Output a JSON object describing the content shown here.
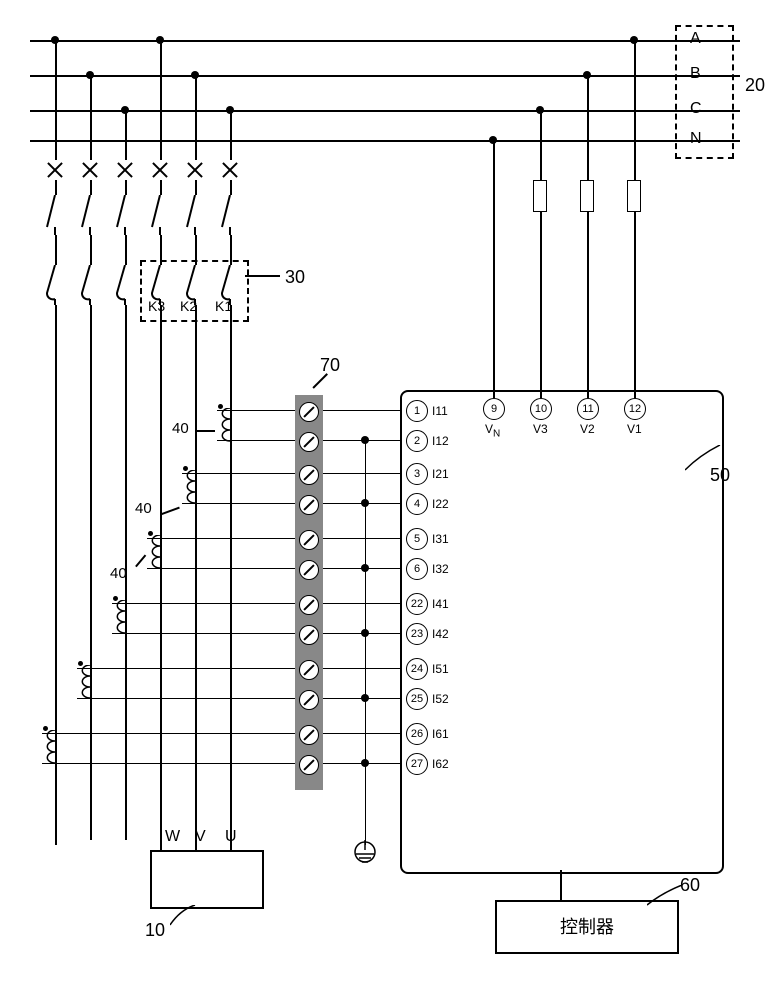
{
  "bus": {
    "A": "A",
    "B": "B",
    "C": "C",
    "N": "N"
  },
  "contactor": {
    "K1": "K1",
    "K2": "K2",
    "K3": "K3"
  },
  "motor_terminals": {
    "W": "W",
    "V": "V",
    "U": "U"
  },
  "ct_label": "40",
  "terminal_strip": "70",
  "device_terminals": {
    "t1": {
      "num": "1",
      "name": "I11"
    },
    "t2": {
      "num": "2",
      "name": "I12"
    },
    "t3": {
      "num": "3",
      "name": "I21"
    },
    "t4": {
      "num": "4",
      "name": "I22"
    },
    "t5": {
      "num": "5",
      "name": "I31"
    },
    "t6": {
      "num": "6",
      "name": "I32"
    },
    "t22": {
      "num": "22",
      "name": "I41"
    },
    "t23": {
      "num": "23",
      "name": "I42"
    },
    "t24": {
      "num": "24",
      "name": "I51"
    },
    "t25": {
      "num": "25",
      "name": "I52"
    },
    "t26": {
      "num": "26",
      "name": "I61"
    },
    "t27": {
      "num": "27",
      "name": "I62"
    },
    "t9": {
      "num": "9",
      "name": "V"
    },
    "t9sub": "N",
    "t10": {
      "num": "10",
      "name": "V3"
    },
    "t11": {
      "num": "11",
      "name": "V2"
    },
    "t12": {
      "num": "12",
      "name": "V1"
    }
  },
  "refs": {
    "bus_group": "20",
    "contactor_group": "30",
    "load": "10",
    "device": "50",
    "controller": "60"
  },
  "controller_label": "控制器"
}
